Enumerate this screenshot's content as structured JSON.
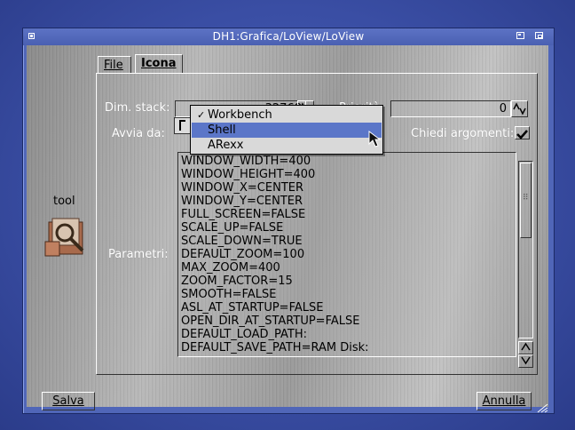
{
  "window": {
    "title": "DH1:Grafica/LoView/LoView"
  },
  "tabs": [
    {
      "label": "File",
      "active": false
    },
    {
      "label": "Icona",
      "active": true
    }
  ],
  "fields": {
    "stack_label": "Dim. stack:",
    "stack_value": "32768",
    "priority_label": "Priorità:",
    "priority_value": "0",
    "start_label": "Avvia da:",
    "ask_args_label": "Chiedi argomenti:",
    "ask_args_checked": true,
    "params_label": "Parametri:"
  },
  "icon": {
    "label": "tool",
    "name": "tool-icon"
  },
  "dropdown": {
    "options": [
      "Workbench",
      "Shell",
      "ARexx"
    ],
    "checked_index": 0,
    "highlighted_index": 1,
    "check_glyph": "✓"
  },
  "tooltypes": [
    "WINDOW_WIDTH=400",
    "WINDOW_HEIGHT=400",
    "WINDOW_X=CENTER",
    "WINDOW_Y=CENTER",
    "FULL_SCREEN=FALSE",
    "SCALE_UP=FALSE",
    "SCALE_DOWN=TRUE",
    "DEFAULT_ZOOM=100",
    "MAX_ZOOM=400",
    "ZOOM_FACTOR=15",
    "SMOOTH=FALSE",
    "ASL_AT_STARTUP=FALSE",
    "OPEN_DIR_AT_STARTUP=FALSE",
    "DEFAULT_LOAD_PATH:",
    "DEFAULT_SAVE_PATH=RAM Disk:"
  ],
  "buttons": {
    "save": "Salva",
    "cancel": "Annulla"
  },
  "colors": {
    "desktop": "#3a4ea4",
    "titlebar": "#5066b8",
    "highlight": "#5b76c8"
  }
}
